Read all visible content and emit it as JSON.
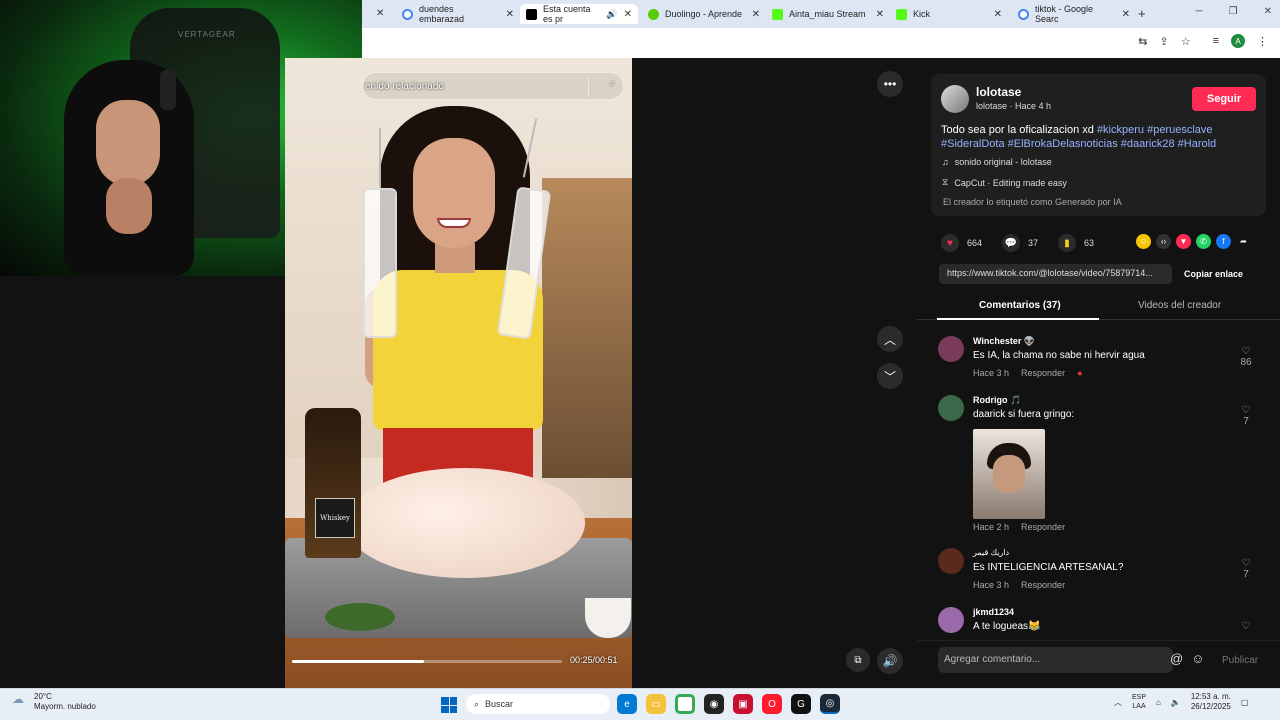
{
  "browser": {
    "tabs": [
      {
        "title": "duendes embarazad",
        "favicon_color": "#4285f4"
      },
      {
        "title": "Esta cuenta es pr",
        "favicon_color": "#000000",
        "active": true
      },
      {
        "title": "Duolingo - Aprende",
        "favicon_color": "#58cc02"
      },
      {
        "title": "Ainta_miau Stream",
        "favicon_color": "#53fc18"
      },
      {
        "title": "Kick",
        "favicon_color": "#53fc18"
      },
      {
        "title": "tiktok - Google Searc",
        "favicon_color": "#4285f4"
      }
    ],
    "new_tab": "+",
    "profile_initial": "A"
  },
  "webcam": {
    "chair_brand": "VERTAGEAR"
  },
  "video": {
    "search_placeholder": "enido relacionado",
    "bottle_label": "Whiskey",
    "time": "00:25/00:51",
    "progress": 0.49
  },
  "creator": {
    "username": "lolotase",
    "subline": "lolotase · Hace 4 h",
    "follow_label": "Seguir",
    "description_text": "Todo sea por la oficalizacion xd ",
    "hashtags": [
      "#kickperu",
      "#peruesclave",
      "#SideralDota",
      "#ElBrokaDelasnoticias",
      "#daarick28",
      "#Harold"
    ],
    "sound": "sonido original - lolotase",
    "capcut": "CapCut · Editing made easy",
    "ai_label": "El creador lo etiquetó como Generado por IA"
  },
  "stats": {
    "likes": "664",
    "comments": "37",
    "saves": "63"
  },
  "link": {
    "url": "https://www.tiktok.com/@lolotase/video/75879714...",
    "copy_label": "Copiar enlace"
  },
  "panel_tabs": {
    "comments": "Comentarios (37)",
    "creator_videos": "Videos del creador"
  },
  "comments": [
    {
      "name": "Winchester 👽",
      "text": "Es IA, la chama no sabe ni hervir agua",
      "time": "Hace 3 h",
      "reply": "Responder",
      "likes": "86",
      "avatar_color": "#7a3a5a"
    },
    {
      "name": "Rodrigo 🎵",
      "text": "daarick si fuera gringo:",
      "time": "Hace 2 h",
      "reply": "Responder",
      "likes": "7",
      "avatar_color": "#3a6a4a"
    },
    {
      "name": "داريك قيمر",
      "text": "Es INTELIGENCIA ARTESANAL?",
      "time": "Hace 3 h",
      "reply": "Responder",
      "likes": "7",
      "avatar_color": "#5a2a1a"
    },
    {
      "name": "jkmd1234",
      "text": "A te logueas😹",
      "avatar_color": "#9a6aaa"
    }
  ],
  "comment_input": {
    "placeholder": "Agregar comentario...",
    "publish": "Publicar"
  },
  "taskbar": {
    "temp": "20°C",
    "weather": "Mayorm. nublado",
    "search": "Buscar",
    "lang1": "ESP",
    "lang2": "LAA",
    "time": "12:53 a. m.",
    "date": "26/12/2025"
  }
}
